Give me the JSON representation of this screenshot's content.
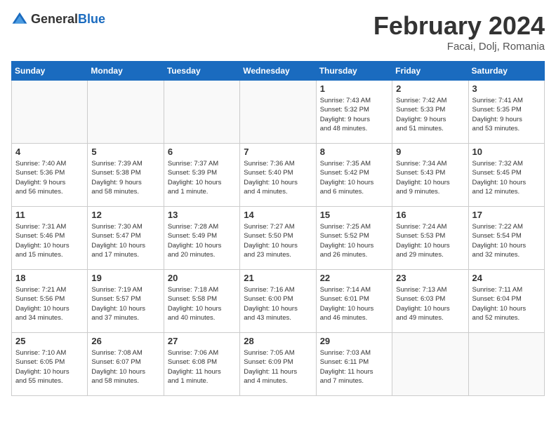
{
  "header": {
    "logo_general": "General",
    "logo_blue": "Blue",
    "month_title": "February 2024",
    "location": "Facai, Dolj, Romania"
  },
  "days_of_week": [
    "Sunday",
    "Monday",
    "Tuesday",
    "Wednesday",
    "Thursday",
    "Friday",
    "Saturday"
  ],
  "weeks": [
    [
      {
        "day": "",
        "info": ""
      },
      {
        "day": "",
        "info": ""
      },
      {
        "day": "",
        "info": ""
      },
      {
        "day": "",
        "info": ""
      },
      {
        "day": "1",
        "info": "Sunrise: 7:43 AM\nSunset: 5:32 PM\nDaylight: 9 hours\nand 48 minutes."
      },
      {
        "day": "2",
        "info": "Sunrise: 7:42 AM\nSunset: 5:33 PM\nDaylight: 9 hours\nand 51 minutes."
      },
      {
        "day": "3",
        "info": "Sunrise: 7:41 AM\nSunset: 5:35 PM\nDaylight: 9 hours\nand 53 minutes."
      }
    ],
    [
      {
        "day": "4",
        "info": "Sunrise: 7:40 AM\nSunset: 5:36 PM\nDaylight: 9 hours\nand 56 minutes."
      },
      {
        "day": "5",
        "info": "Sunrise: 7:39 AM\nSunset: 5:38 PM\nDaylight: 9 hours\nand 58 minutes."
      },
      {
        "day": "6",
        "info": "Sunrise: 7:37 AM\nSunset: 5:39 PM\nDaylight: 10 hours\nand 1 minute."
      },
      {
        "day": "7",
        "info": "Sunrise: 7:36 AM\nSunset: 5:40 PM\nDaylight: 10 hours\nand 4 minutes."
      },
      {
        "day": "8",
        "info": "Sunrise: 7:35 AM\nSunset: 5:42 PM\nDaylight: 10 hours\nand 6 minutes."
      },
      {
        "day": "9",
        "info": "Sunrise: 7:34 AM\nSunset: 5:43 PM\nDaylight: 10 hours\nand 9 minutes."
      },
      {
        "day": "10",
        "info": "Sunrise: 7:32 AM\nSunset: 5:45 PM\nDaylight: 10 hours\nand 12 minutes."
      }
    ],
    [
      {
        "day": "11",
        "info": "Sunrise: 7:31 AM\nSunset: 5:46 PM\nDaylight: 10 hours\nand 15 minutes."
      },
      {
        "day": "12",
        "info": "Sunrise: 7:30 AM\nSunset: 5:47 PM\nDaylight: 10 hours\nand 17 minutes."
      },
      {
        "day": "13",
        "info": "Sunrise: 7:28 AM\nSunset: 5:49 PM\nDaylight: 10 hours\nand 20 minutes."
      },
      {
        "day": "14",
        "info": "Sunrise: 7:27 AM\nSunset: 5:50 PM\nDaylight: 10 hours\nand 23 minutes."
      },
      {
        "day": "15",
        "info": "Sunrise: 7:25 AM\nSunset: 5:52 PM\nDaylight: 10 hours\nand 26 minutes."
      },
      {
        "day": "16",
        "info": "Sunrise: 7:24 AM\nSunset: 5:53 PM\nDaylight: 10 hours\nand 29 minutes."
      },
      {
        "day": "17",
        "info": "Sunrise: 7:22 AM\nSunset: 5:54 PM\nDaylight: 10 hours\nand 32 minutes."
      }
    ],
    [
      {
        "day": "18",
        "info": "Sunrise: 7:21 AM\nSunset: 5:56 PM\nDaylight: 10 hours\nand 34 minutes."
      },
      {
        "day": "19",
        "info": "Sunrise: 7:19 AM\nSunset: 5:57 PM\nDaylight: 10 hours\nand 37 minutes."
      },
      {
        "day": "20",
        "info": "Sunrise: 7:18 AM\nSunset: 5:58 PM\nDaylight: 10 hours\nand 40 minutes."
      },
      {
        "day": "21",
        "info": "Sunrise: 7:16 AM\nSunset: 6:00 PM\nDaylight: 10 hours\nand 43 minutes."
      },
      {
        "day": "22",
        "info": "Sunrise: 7:14 AM\nSunset: 6:01 PM\nDaylight: 10 hours\nand 46 minutes."
      },
      {
        "day": "23",
        "info": "Sunrise: 7:13 AM\nSunset: 6:03 PM\nDaylight: 10 hours\nand 49 minutes."
      },
      {
        "day": "24",
        "info": "Sunrise: 7:11 AM\nSunset: 6:04 PM\nDaylight: 10 hours\nand 52 minutes."
      }
    ],
    [
      {
        "day": "25",
        "info": "Sunrise: 7:10 AM\nSunset: 6:05 PM\nDaylight: 10 hours\nand 55 minutes."
      },
      {
        "day": "26",
        "info": "Sunrise: 7:08 AM\nSunset: 6:07 PM\nDaylight: 10 hours\nand 58 minutes."
      },
      {
        "day": "27",
        "info": "Sunrise: 7:06 AM\nSunset: 6:08 PM\nDaylight: 11 hours\nand 1 minute."
      },
      {
        "day": "28",
        "info": "Sunrise: 7:05 AM\nSunset: 6:09 PM\nDaylight: 11 hours\nand 4 minutes."
      },
      {
        "day": "29",
        "info": "Sunrise: 7:03 AM\nSunset: 6:11 PM\nDaylight: 11 hours\nand 7 minutes."
      },
      {
        "day": "",
        "info": ""
      },
      {
        "day": "",
        "info": ""
      }
    ]
  ]
}
